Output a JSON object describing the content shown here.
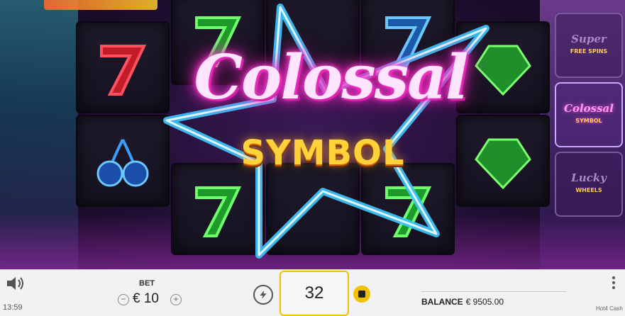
{
  "game": {
    "title": "Hot4 Cash",
    "feature_title": "Colossal",
    "feature_subtitle": "SYMBOL"
  },
  "reels": [
    {
      "col": 1,
      "row": 1,
      "symbol": "red-seven"
    },
    {
      "col": 1,
      "row": 2,
      "symbol": "blue-cherries"
    },
    {
      "col": 2,
      "row": 1,
      "symbol": "green-seven"
    },
    {
      "col": 4,
      "row": 1,
      "symbol": "blue-seven"
    },
    {
      "col": 4,
      "row": 3,
      "symbol": "green-seven"
    },
    {
      "col": 5,
      "row": 1,
      "symbol": "green-gem"
    },
    {
      "col": 5,
      "row": 2,
      "symbol": "green-gem"
    }
  ],
  "side_features": [
    {
      "line1": "Super",
      "line2": "FREE SPINS",
      "active": false
    },
    {
      "line1": "Colossal",
      "line2": "SYMBOL",
      "active": true
    },
    {
      "line1": "Lucky",
      "line2": "WHEELS",
      "active": false
    }
  ],
  "bottom_bar": {
    "clock": "13:59",
    "bet_label": "BET",
    "bet_value": "€ 10",
    "spin_value": "32",
    "balance_label": "BALANCE",
    "balance_value": "€ 9505.00",
    "game_name": "Hot4 Cash"
  },
  "colors": {
    "accent_yellow": "#f2c200",
    "neon_pink": "#ff4bd8",
    "neon_blue": "#3ec8ff",
    "bar_bg": "#f2f2f4"
  },
  "icons": {
    "sound": "speaker-icon",
    "turbo": "lightning-icon",
    "autoplay": "stop-icon",
    "menu": "kebab-menu-icon"
  }
}
